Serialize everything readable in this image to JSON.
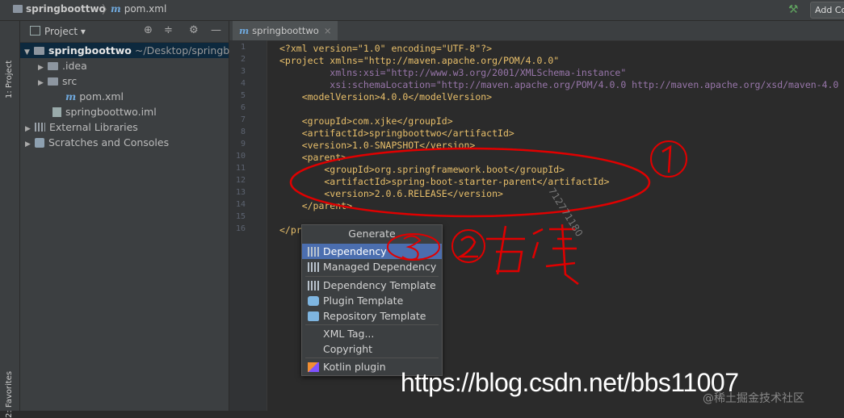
{
  "titlebar": {
    "project_name": "springboottwo",
    "file_name": "pom.xml",
    "add_config_label": "Add Co"
  },
  "side_tabs": {
    "project": "1: Project",
    "favorites": "2: Favorites"
  },
  "project_panel": {
    "title": "Project",
    "tree": [
      {
        "label": "springboottwo",
        "path": "~/Desktop/springbo",
        "depth": 0,
        "expanded": true,
        "selected": true,
        "icon": "module-folder-icon"
      },
      {
        "label": ".idea",
        "depth": 1,
        "expanded": false,
        "icon": "folder-icon"
      },
      {
        "label": "src",
        "depth": 1,
        "expanded": false,
        "icon": "folder-icon"
      },
      {
        "label": "pom.xml",
        "depth": 1,
        "icon": "maven-icon"
      },
      {
        "label": "springboottwo.iml",
        "depth": 1,
        "icon": "iml-file-icon"
      },
      {
        "label": "External Libraries",
        "depth": 0,
        "expanded": false,
        "icon": "libraries-icon"
      },
      {
        "label": "Scratches and Consoles",
        "depth": 0,
        "expanded": false,
        "icon": "scratches-icon"
      }
    ]
  },
  "editor": {
    "tab_label": "springboottwo",
    "line_numbers": [
      "1",
      "2",
      "3",
      "4",
      "5",
      "6",
      "7",
      "8",
      "9",
      "10",
      "11",
      "12",
      "13",
      "14",
      "15",
      "16"
    ],
    "lines": {
      "l1": "<?xml version=\"1.0\" encoding=\"UTF-8\"?>",
      "l2": "<project xmlns=\"http://maven.apache.org/POM/4.0.0\"",
      "l3": "         xmlns:xsi=\"http://www.w3.org/2001/XMLSchema-instance\"",
      "l4": "         xsi:schemaLocation=\"http://maven.apache.org/POM/4.0.0 http://maven.apache.org/xsd/maven-4.0",
      "l5": "    <modelVersion>4.0.0</modelVersion>",
      "l6": "",
      "l7": "    <groupId>com.xjke</groupId>",
      "l8": "    <artifactId>springboottwo</artifactId>",
      "l9": "    <version>1.0-SNAPSHOT</version>",
      "l10": "    <parent>",
      "l11": "        <groupId>org.springframework.boot</groupId>",
      "l12": "        <artifactId>spring-boot-starter-parent</artifactId>",
      "l13": "        <version>2.0.6.RELEASE</version>",
      "l14": "    </parent>",
      "l15": "",
      "l16": "</pr"
    }
  },
  "generate_popup": {
    "title": "Generate",
    "items": [
      {
        "label": "Dependency",
        "icon": "maven-library-icon",
        "highlighted": true
      },
      {
        "label": "Managed Dependency",
        "icon": "maven-library-icon"
      },
      {
        "label": "Dependency Template",
        "icon": "maven-library-icon"
      },
      {
        "label": "Plugin Template",
        "icon": "plugin-icon"
      },
      {
        "label": "Repository Template",
        "icon": "repository-icon"
      },
      {
        "label": "XML Tag...",
        "icon": ""
      },
      {
        "label": "Copyright",
        "icon": ""
      },
      {
        "label": "Kotlin plugin",
        "icon": "kotlin-icon"
      }
    ]
  },
  "annotations": {
    "mark1": "①",
    "mark2": "②右键",
    "mark3": "③",
    "scrawl": "712771180",
    "color": "#e00000"
  },
  "watermark": "https://blog.csdn.net/bbs11007",
  "juejin_mark": "@稀土掘金技术社区"
}
